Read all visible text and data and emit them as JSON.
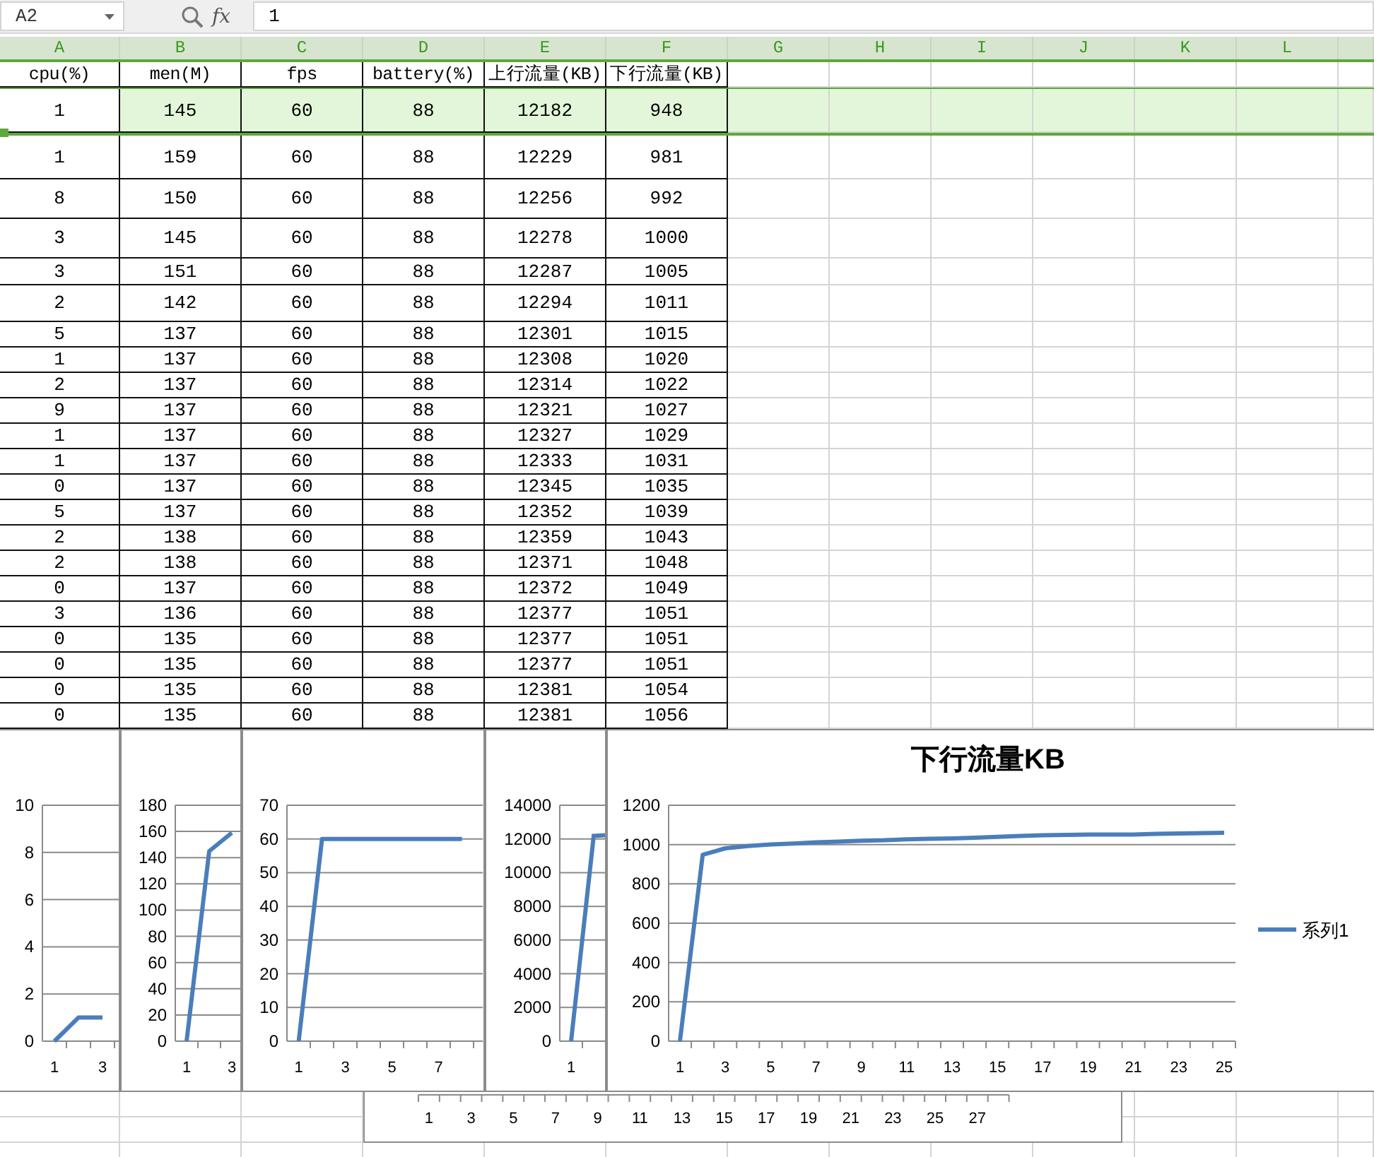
{
  "formula_bar": {
    "name_box": "A2",
    "function_label": "fx",
    "formula": "1"
  },
  "columns": [
    {
      "letter": "A",
      "selected": true
    },
    {
      "letter": "B",
      "selected": true
    },
    {
      "letter": "C",
      "selected": true
    },
    {
      "letter": "D",
      "selected": true
    },
    {
      "letter": "E",
      "selected": true
    },
    {
      "letter": "F",
      "selected": true
    },
    {
      "letter": "G",
      "selected": true
    },
    {
      "letter": "H",
      "selected": true
    },
    {
      "letter": "I",
      "selected": true
    },
    {
      "letter": "J",
      "selected": true
    },
    {
      "letter": "K",
      "selected": true
    },
    {
      "letter": "L",
      "selected": true
    }
  ],
  "table": {
    "header": [
      "cpu(%)",
      "men(M)",
      "fps",
      "battery(%)",
      "上行流量(KB)",
      "下行流量(KB)"
    ],
    "rows": [
      {
        "selected": true,
        "cells": [
          "1",
          "145",
          "60",
          "88",
          "12182",
          "948"
        ]
      },
      {
        "selected": false,
        "cells": [
          "1",
          "159",
          "60",
          "88",
          "12229",
          "981"
        ]
      },
      {
        "selected": false,
        "cells": [
          "8",
          "150",
          "60",
          "88",
          "12256",
          "992"
        ]
      },
      {
        "selected": false,
        "cells": [
          "3",
          "145",
          "60",
          "88",
          "12278",
          "1000"
        ]
      },
      {
        "selected": false,
        "cells": [
          "3",
          "151",
          "60",
          "88",
          "12287",
          "1005"
        ]
      },
      {
        "selected": false,
        "cells": [
          "2",
          "142",
          "60",
          "88",
          "12294",
          "1011"
        ]
      },
      {
        "selected": false,
        "cells": [
          "5",
          "137",
          "60",
          "88",
          "12301",
          "1015"
        ]
      },
      {
        "selected": false,
        "cells": [
          "1",
          "137",
          "60",
          "88",
          "12308",
          "1020"
        ]
      },
      {
        "selected": false,
        "cells": [
          "2",
          "137",
          "60",
          "88",
          "12314",
          "1022"
        ]
      },
      {
        "selected": false,
        "cells": [
          "9",
          "137",
          "60",
          "88",
          "12321",
          "1027"
        ]
      },
      {
        "selected": false,
        "cells": [
          "1",
          "137",
          "60",
          "88",
          "12327",
          "1029"
        ]
      },
      {
        "selected": false,
        "cells": [
          "1",
          "137",
          "60",
          "88",
          "12333",
          "1031"
        ]
      },
      {
        "selected": false,
        "cells": [
          "0",
          "137",
          "60",
          "88",
          "12345",
          "1035"
        ]
      },
      {
        "selected": false,
        "cells": [
          "5",
          "137",
          "60",
          "88",
          "12352",
          "1039"
        ]
      },
      {
        "selected": false,
        "cells": [
          "2",
          "138",
          "60",
          "88",
          "12359",
          "1043"
        ]
      },
      {
        "selected": false,
        "cells": [
          "2",
          "138",
          "60",
          "88",
          "12371",
          "1048"
        ]
      },
      {
        "selected": false,
        "cells": [
          "0",
          "137",
          "60",
          "88",
          "12372",
          "1049"
        ]
      },
      {
        "selected": false,
        "cells": [
          "3",
          "136",
          "60",
          "88",
          "12377",
          "1051"
        ]
      },
      {
        "selected": false,
        "cells": [
          "0",
          "135",
          "60",
          "88",
          "12377",
          "1051"
        ]
      },
      {
        "selected": false,
        "cells": [
          "0",
          "135",
          "60",
          "88",
          "12377",
          "1051"
        ]
      },
      {
        "selected": false,
        "cells": [
          "0",
          "135",
          "60",
          "88",
          "12381",
          "1054"
        ]
      },
      {
        "selected": false,
        "cells": [
          "0",
          "135",
          "60",
          "88",
          "12381",
          "1056"
        ]
      }
    ]
  },
  "partial_chart": {
    "x_labels": [
      "1",
      "3",
      "5",
      "7",
      "9",
      "11",
      "13",
      "15",
      "17",
      "19",
      "21",
      "23",
      "25",
      "27"
    ]
  },
  "charts": [
    {
      "chart_data": {
        "type": "line",
        "grid": true,
        "x": [
          1,
          2,
          3
        ],
        "series": [
          {
            "color": "#4a7ebb",
            "values": [
              0,
              1,
              1
            ]
          }
        ],
        "xlim": [
          0.5,
          3.7
        ],
        "ylim": [
          0,
          10
        ],
        "yticks": [
          0,
          2,
          4,
          6,
          8,
          10
        ],
        "xticks": [
          1,
          3
        ]
      }
    },
    {
      "chart_data": {
        "type": "line",
        "grid": true,
        "x": [
          1,
          2,
          3
        ],
        "series": [
          {
            "color": "#4a7ebb",
            "values": [
              0,
              145,
              159
            ]
          }
        ],
        "xlim": [
          0.5,
          3.4
        ],
        "ylim": [
          0,
          180
        ],
        "yticks": [
          0,
          20,
          40,
          60,
          80,
          100,
          120,
          140,
          160,
          180
        ],
        "xticks": [
          1,
          3
        ]
      }
    },
    {
      "chart_data": {
        "type": "line",
        "grid": true,
        "x": [
          1,
          2,
          3,
          4,
          5,
          6,
          7,
          8
        ],
        "series": [
          {
            "color": "#4a7ebb",
            "values": [
              0,
              60,
              60,
              60,
              60,
              60,
              60,
              60
            ]
          }
        ],
        "xlim": [
          0.5,
          8.9
        ],
        "ylim": [
          0,
          70
        ],
        "yticks": [
          0,
          10,
          20,
          30,
          40,
          50,
          60,
          70
        ],
        "xticks": [
          1,
          3,
          5,
          7
        ]
      }
    },
    {
      "y_labels": [
        "14000",
        "12000",
        "10000",
        "8000",
        "6000",
        "4000",
        "2000",
        "0"
      ],
      "x_labels": [
        "1"
      ]
    },
    {
      "chart_data": {
        "type": "line",
        "grid": true,
        "title": "下行流量KB",
        "x": [
          1,
          2,
          3,
          4,
          5,
          6,
          7,
          8,
          9,
          10,
          11,
          12,
          13,
          14,
          15,
          16,
          17,
          18,
          19,
          20,
          21,
          22,
          23,
          24,
          25
        ],
        "series": [
          {
            "name": "系列1",
            "color": "#4a7ebb",
            "values": [
              0,
              948,
              981,
              992,
              1000,
              1005,
              1011,
              1015,
              1020,
              1022,
              1027,
              1029,
              1031,
              1035,
              1039,
              1043,
              1048,
              1049,
              1051,
              1051,
              1051,
              1054,
              1056,
              1058,
              1060
            ]
          }
        ],
        "xlim": [
          0.5,
          25.5
        ],
        "ylim": [
          0,
          1200
        ],
        "yticks": [
          0,
          200,
          400,
          600,
          800,
          1000,
          1200
        ],
        "xticks": [
          1,
          3,
          5,
          7,
          9,
          11,
          13,
          15,
          17,
          19,
          21,
          23,
          25
        ]
      }
    }
  ]
}
